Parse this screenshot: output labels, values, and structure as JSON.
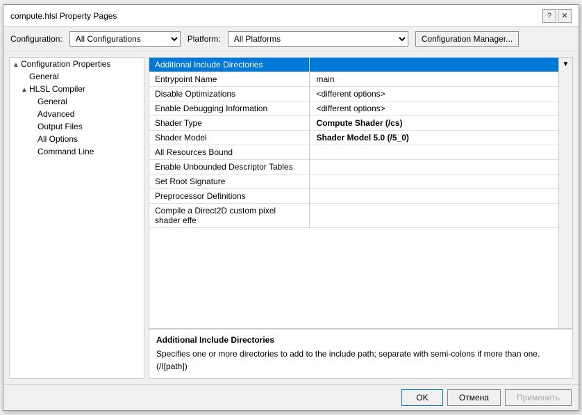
{
  "window": {
    "title": "compute.hlsl Property Pages",
    "help_btn": "?",
    "close_btn": "✕"
  },
  "config_row": {
    "config_label": "Configuration:",
    "config_value": "All Configurations",
    "platform_label": "Platform:",
    "platform_value": "All Platforms",
    "manager_btn": "Configuration Manager..."
  },
  "tree": {
    "items": [
      {
        "label": "Configuration Properties",
        "level": 0,
        "expand": "▲",
        "selected": false
      },
      {
        "label": "General",
        "level": 1,
        "expand": "",
        "selected": false
      },
      {
        "label": "HLSL Compiler",
        "level": 1,
        "expand": "▲",
        "selected": false
      },
      {
        "label": "General",
        "level": 2,
        "expand": "",
        "selected": false
      },
      {
        "label": "Advanced",
        "level": 2,
        "expand": "",
        "selected": false
      },
      {
        "label": "Output Files",
        "level": 2,
        "expand": "",
        "selected": false
      },
      {
        "label": "All Options",
        "level": 2,
        "expand": "",
        "selected": false
      },
      {
        "label": "Command Line",
        "level": 2,
        "expand": "",
        "selected": false
      }
    ]
  },
  "properties": {
    "selected_row": 0,
    "rows": [
      {
        "name": "Additional Include Directories",
        "value": "",
        "bold": false,
        "selected": true
      },
      {
        "name": "Entrypoint Name",
        "value": "main",
        "bold": false,
        "selected": false
      },
      {
        "name": "Disable Optimizations",
        "value": "<different options>",
        "bold": false,
        "selected": false
      },
      {
        "name": "Enable Debugging Information",
        "value": "<different options>",
        "bold": false,
        "selected": false
      },
      {
        "name": "Shader Type",
        "value": "Compute Shader (/cs)",
        "bold": true,
        "selected": false
      },
      {
        "name": "Shader Model",
        "value": "Shader Model 5.0 (/5_0)",
        "bold": true,
        "selected": false
      },
      {
        "name": "All Resources Bound",
        "value": "",
        "bold": false,
        "selected": false
      },
      {
        "name": "Enable Unbounded Descriptor Tables",
        "value": "",
        "bold": false,
        "selected": false
      },
      {
        "name": "Set Root Signature",
        "value": "",
        "bold": false,
        "selected": false
      },
      {
        "name": "Preprocessor Definitions",
        "value": "",
        "bold": false,
        "selected": false
      },
      {
        "name": "Compile a Direct2D custom pixel shader effe",
        "value": "",
        "bold": false,
        "selected": false
      }
    ]
  },
  "description": {
    "title": "Additional Include Directories",
    "text": "Specifies one or more directories to add to the include path; separate with semi-colons if more than one. (/I[path])"
  },
  "footer": {
    "ok_label": "OK",
    "cancel_label": "Отмена",
    "apply_label": "Применить"
  }
}
